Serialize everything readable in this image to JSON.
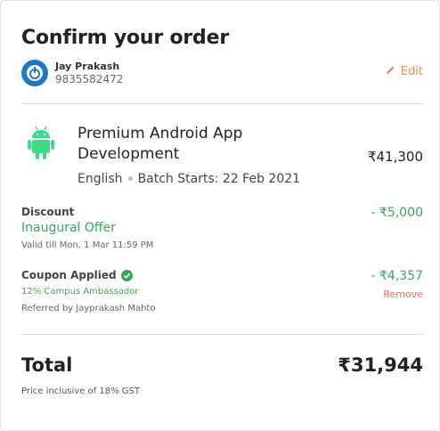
{
  "page": {
    "title": "Confirm your order"
  },
  "user": {
    "name": "Jay Prakash",
    "phone": "9835582472",
    "avatar_icon": "power-icon"
  },
  "edit": {
    "label": "Edit",
    "icon": "pencil-icon"
  },
  "course": {
    "icon": "android-icon",
    "name": "Premium Android App Development",
    "price": "₹41,300",
    "language": "English",
    "batch": "Batch Starts: 22 Feb 2021"
  },
  "discount": {
    "label": "Discount",
    "offer": "Inaugural Offer",
    "valid": "Valid till Mon, 1 Mar 11:59 PM",
    "amount": "- ₹5,000"
  },
  "coupon": {
    "label": "Coupon Applied",
    "icon": "check-circle-icon",
    "name": "12% Campus Ambassador",
    "referred": "Referred by Jayprakash Mahto",
    "amount": "- ₹4,357",
    "remove_label": "Remove"
  },
  "total": {
    "label": "Total",
    "amount": "₹31,944",
    "note": "Price inclusive of 18% GST"
  },
  "colors": {
    "accent": "#ef8a5a",
    "green": "#3ba55c",
    "android": "#3ddc84",
    "avatar": "#1e78c8"
  }
}
